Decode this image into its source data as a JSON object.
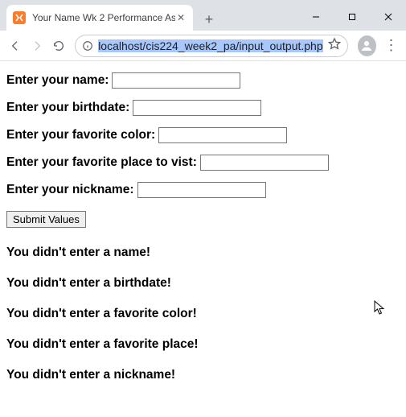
{
  "chrome": {
    "tab_title": "Your Name Wk 2 Performance As",
    "url_host": "localhost",
    "url_path": "/cis224_week2_pa/input_output.php"
  },
  "form": {
    "name_label": "Enter your name:",
    "birthdate_label": "Enter your birthdate:",
    "color_label": "Enter your favorite color:",
    "place_label": "Enter your favorite place to vist:",
    "nickname_label": "Enter your nickname:",
    "submit_label": "Submit Values",
    "name_value": "",
    "birthdate_value": "",
    "color_value": "",
    "place_value": "",
    "nickname_value": ""
  },
  "messages": {
    "no_name": "You didn't enter a name!",
    "no_birthdate": "You didn't enter a birthdate!",
    "no_color": "You didn't enter a favorite color!",
    "no_place": "You didn't enter a favorite place!",
    "no_nickname": "You didn't enter a nickname!"
  }
}
